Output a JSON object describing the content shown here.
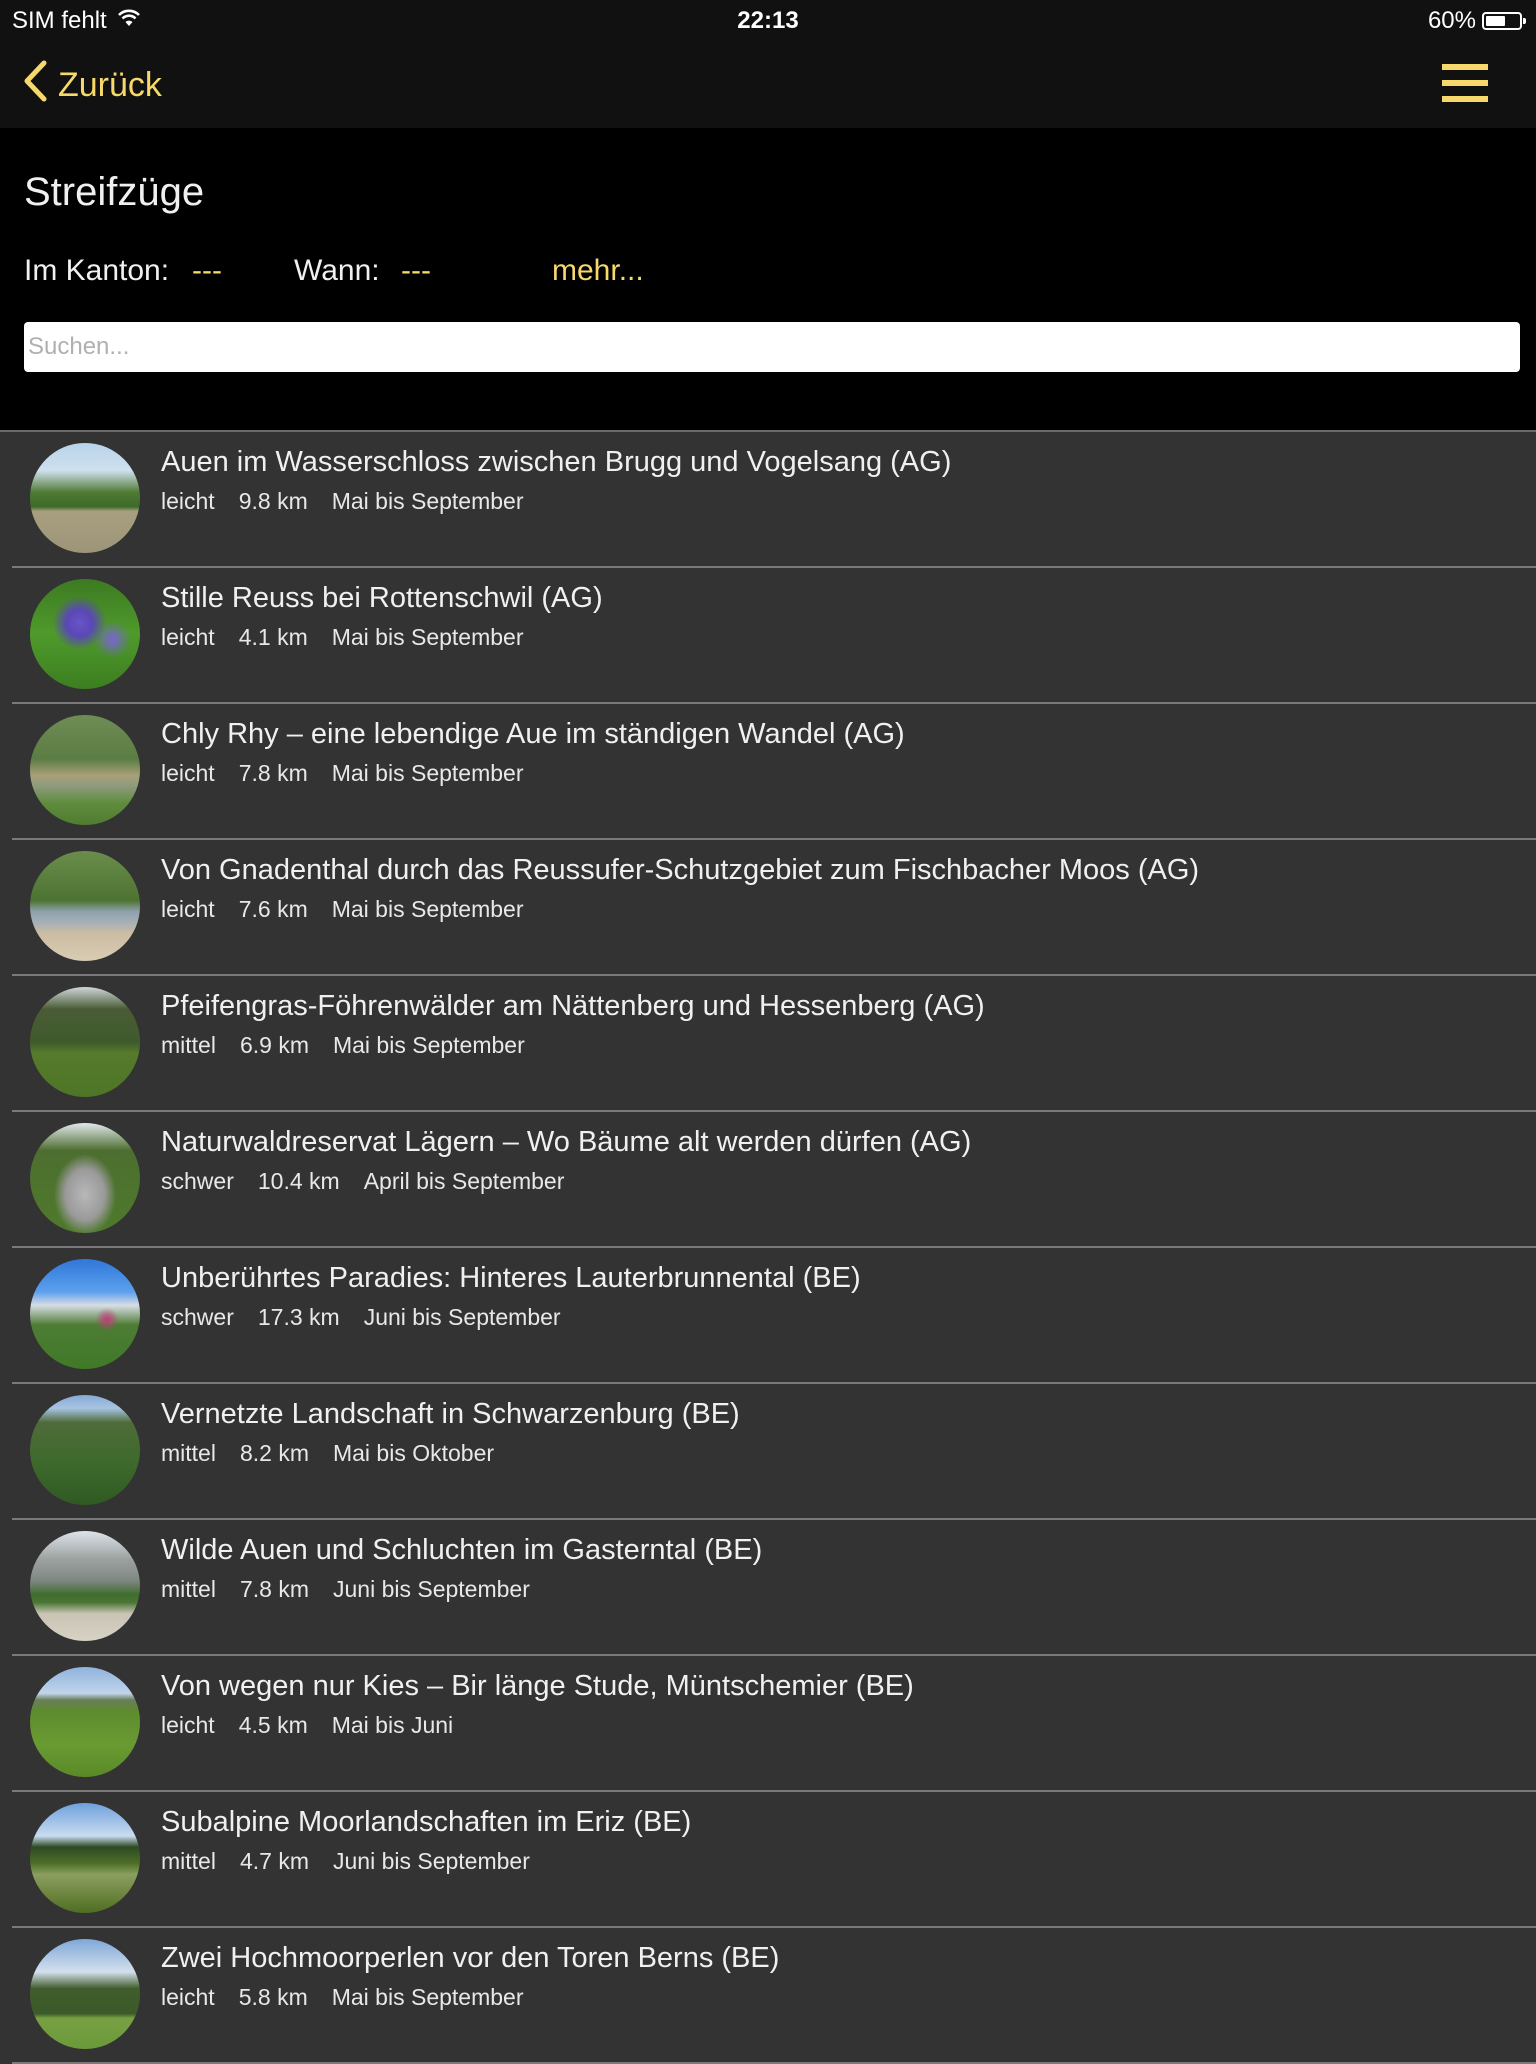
{
  "status_bar": {
    "carrier": "SIM fehlt",
    "time": "22:13",
    "battery_percent": "60%",
    "battery_level": 0.6
  },
  "nav": {
    "back_label": "Zurück",
    "back_icon": "chevron-left-icon",
    "menu_icon": "hamburger-menu-icon"
  },
  "header": {
    "title": "Streifzüge",
    "canton_label": "Im Kanton:",
    "canton_value": "---",
    "when_label": "Wann:",
    "when_value": "---",
    "more_label": "mehr..."
  },
  "search": {
    "placeholder": "Suchen...",
    "value": ""
  },
  "colors": {
    "accent": "#f6d86b",
    "list_bg": "#333333",
    "header_bg": "#000000",
    "bar_bg": "#111111"
  },
  "routes": [
    {
      "title": "Auen im Wasserschloss zwischen Brugg und Vogelsang (AG)",
      "difficulty": "leicht",
      "distance": "9.8 km",
      "season": "Mai bis September",
      "thumb": "river-floodplain"
    },
    {
      "title": "Stille Reuss bei Rottenschwil (AG)",
      "difficulty": "leicht",
      "distance": "4.1 km",
      "season": "Mai bis September",
      "thumb": "iris-meadow"
    },
    {
      "title": "Chly Rhy – eine lebendige Aue im ständigen Wandel (AG)",
      "difficulty": "leicht",
      "distance": "7.8 km",
      "season": "Mai bis September",
      "thumb": "pond-forest"
    },
    {
      "title": "Von Gnadenthal durch das Reussufer-Schutzgebiet zum Fischbacher Moos (AG)",
      "difficulty": "leicht",
      "distance": "7.6 km",
      "season": "Mai bis September",
      "thumb": "river-gravel"
    },
    {
      "title": "Pfeifengras-Föhrenwälder am Nättenberg und Hessenberg (AG)",
      "difficulty": "mittel",
      "distance": "6.9 km",
      "season": "Mai bis September",
      "thumb": "pine-meadow"
    },
    {
      "title": "Naturwaldreservat Lägern – Wo Bäume alt werden dürfen (AG)",
      "difficulty": "schwer",
      "distance": "10.4 km",
      "season": "April bis September",
      "thumb": "rock-ridge"
    },
    {
      "title": "Unberührtes Paradies: Hinteres Lauterbrunnental (BE)",
      "difficulty": "schwer",
      "distance": "17.3 km",
      "season": "Juni bis September",
      "thumb": "alpine-flowers"
    },
    {
      "title": "Vernetzte Landschaft in Schwarzenburg (BE)",
      "difficulty": "mittel",
      "distance": "8.2 km",
      "season": "Mai bis Oktober",
      "thumb": "gorge-forest"
    },
    {
      "title": "Wilde Auen und Schluchten im Gasterntal (BE)",
      "difficulty": "mittel",
      "distance": "7.8 km",
      "season": "Juni bis September",
      "thumb": "mountain-valley"
    },
    {
      "title": "Von wegen nur Kies – Bir länge Stude, Müntschemier (BE)",
      "difficulty": "leicht",
      "distance": "4.5 km",
      "season": "Mai bis Juni",
      "thumb": "grass-field"
    },
    {
      "title": "Subalpine Moorlandschaften im Eriz (BE)",
      "difficulty": "mittel",
      "distance": "4.7 km",
      "season": "Juni bis September",
      "thumb": "moor-cotton-grass"
    },
    {
      "title": "Zwei Hochmoorperlen vor den Toren Berns (BE)",
      "difficulty": "leicht",
      "distance": "5.8 km",
      "season": "Mai bis September",
      "thumb": "bog-pines"
    }
  ]
}
